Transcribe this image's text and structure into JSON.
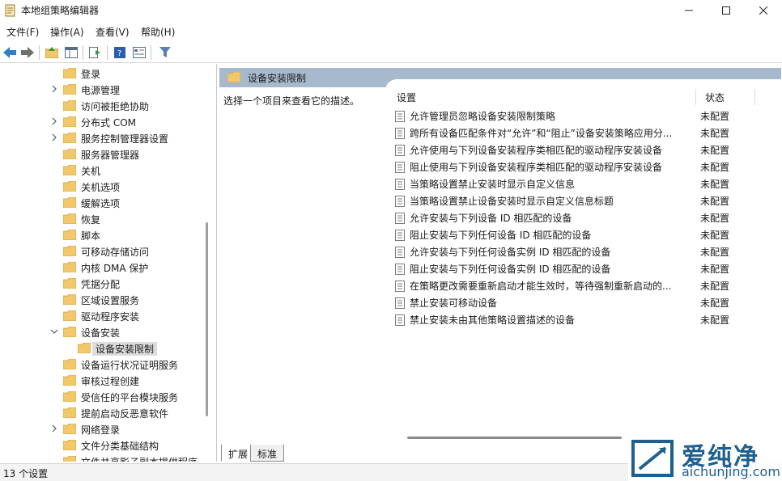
{
  "window": {
    "title": "本地组策略编辑器"
  },
  "menu": [
    "文件(F)",
    "操作(A)",
    "查看(V)",
    "帮助(H)"
  ],
  "tree": {
    "items": [
      {
        "label": "登录",
        "chevron": "none",
        "indent": 0
      },
      {
        "label": "电源管理",
        "chevron": "right",
        "indent": 0
      },
      {
        "label": "访问被拒绝协助",
        "chevron": "none",
        "indent": 0
      },
      {
        "label": "分布式 COM",
        "chevron": "right",
        "indent": 0
      },
      {
        "label": "服务控制管理器设置",
        "chevron": "right",
        "indent": 0
      },
      {
        "label": "服务器管理器",
        "chevron": "none",
        "indent": 0
      },
      {
        "label": "关机",
        "chevron": "none",
        "indent": 0
      },
      {
        "label": "关机选项",
        "chevron": "none",
        "indent": 0
      },
      {
        "label": "缓解选项",
        "chevron": "none",
        "indent": 0
      },
      {
        "label": "恢复",
        "chevron": "none",
        "indent": 0
      },
      {
        "label": "脚本",
        "chevron": "none",
        "indent": 0
      },
      {
        "label": "可移动存储访问",
        "chevron": "none",
        "indent": 0
      },
      {
        "label": "内核 DMA 保护",
        "chevron": "none",
        "indent": 0
      },
      {
        "label": "凭据分配",
        "chevron": "none",
        "indent": 0
      },
      {
        "label": "区域设置服务",
        "chevron": "none",
        "indent": 0
      },
      {
        "label": "驱动程序安装",
        "chevron": "none",
        "indent": 0
      },
      {
        "label": "设备安装",
        "chevron": "down",
        "indent": 0
      },
      {
        "label": "设备安装限制",
        "chevron": "none",
        "indent": 1,
        "selected": true
      },
      {
        "label": "设备运行状况证明服务",
        "chevron": "none",
        "indent": 0
      },
      {
        "label": "审核过程创建",
        "chevron": "none",
        "indent": 0
      },
      {
        "label": "受信任的平台模块服务",
        "chevron": "none",
        "indent": 0
      },
      {
        "label": "提前启动反恶意软件",
        "chevron": "none",
        "indent": 0
      },
      {
        "label": "网络登录",
        "chevron": "right",
        "indent": 0
      },
      {
        "label": "文件分类基础结构",
        "chevron": "none",
        "indent": 0
      },
      {
        "label": "文件共享影子副本提供程序",
        "chevron": "none",
        "indent": 0
      }
    ]
  },
  "content": {
    "header_title": "设备安装限制",
    "description": "选择一个项目来查看它的描述。",
    "col_setting": "设置",
    "col_state": "状态",
    "rows": [
      {
        "name": "允许管理员忽略设备安装限制策略",
        "state": "未配置"
      },
      {
        "name": "跨所有设备匹配条件对“允许”和“阻止”设备安装策略应用分...",
        "state": "未配置"
      },
      {
        "name": "允许使用与下列设备安装程序类相匹配的驱动程序安装设备",
        "state": "未配置"
      },
      {
        "name": "阻止使用与下列设备安装程序类相匹配的驱动程序安装设备",
        "state": "未配置"
      },
      {
        "name": "当策略设置禁止安装时显示自定义信息",
        "state": "未配置"
      },
      {
        "name": "当策略设置禁止设备安装时显示自定义信息标题",
        "state": "未配置"
      },
      {
        "name": "允许安装与下列设备 ID 相匹配的设备",
        "state": "未配置"
      },
      {
        "name": "阻止安装与下列任何设备 ID 相匹配的设备",
        "state": "未配置"
      },
      {
        "name": "允许安装与下列任何设备实例 ID 相匹配的设备",
        "state": "未配置"
      },
      {
        "name": "阻止安装与下列任何设备实例 ID 相匹配的设备",
        "state": "未配置"
      },
      {
        "name": "在策略更改需要重新启动才能生效时，等待强制重新启动的...",
        "state": "未配置"
      },
      {
        "name": "禁止安装可移动设备",
        "state": "未配置"
      },
      {
        "name": "禁止安装未由其他策略设置描述的设备",
        "state": "未配置"
      }
    ]
  },
  "tabs": [
    "扩展",
    "标准"
  ],
  "status": {
    "text": "13 个设置"
  },
  "watermark": {
    "cn": "爱纯净",
    "url": "aichunjing.com"
  },
  "colors": {
    "header_bg": "#a7b9cd",
    "folder": "#f2c96a",
    "watermark": "#1d5f8e"
  }
}
